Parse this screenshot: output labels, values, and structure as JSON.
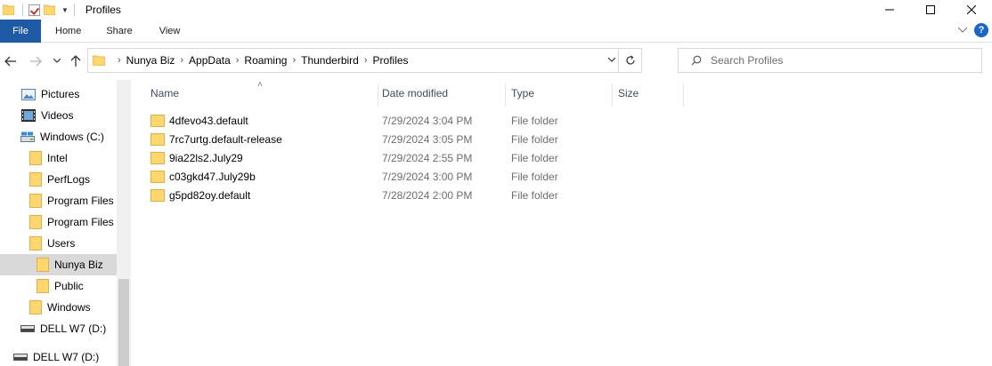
{
  "window": {
    "title": "Profiles"
  },
  "ribbon": {
    "tabs": [
      "File",
      "Home",
      "Share",
      "View"
    ]
  },
  "address": {
    "breadcrumbs": [
      "Nunya Biz",
      "AppData",
      "Roaming",
      "Thunderbird",
      "Profiles"
    ]
  },
  "search": {
    "placeholder": "Search Profiles"
  },
  "nav": {
    "items": [
      {
        "label": "Pictures",
        "icon": "pictures-icon"
      },
      {
        "label": "Videos",
        "icon": "videos-icon"
      },
      {
        "label": "Windows (C:)",
        "icon": "drive-icon"
      },
      {
        "label": "Intel",
        "icon": "folder-icon"
      },
      {
        "label": "PerfLogs",
        "icon": "folder-icon"
      },
      {
        "label": "Program Files",
        "icon": "folder-icon"
      },
      {
        "label": "Program Files (",
        "icon": "folder-icon"
      },
      {
        "label": "Users",
        "icon": "folder-icon"
      },
      {
        "label": "Nunya Biz",
        "icon": "folder-icon",
        "selected": true
      },
      {
        "label": "Public",
        "icon": "folder-icon"
      },
      {
        "label": "Windows",
        "icon": "folder-icon"
      },
      {
        "label": "DELL W7 (D:)",
        "icon": "usb-drive-icon"
      },
      {
        "label": "DELL W7 (D:)",
        "icon": "usb-drive-icon"
      }
    ]
  },
  "table": {
    "columns": [
      "Name",
      "Date modified",
      "Type",
      "Size"
    ],
    "rows": [
      {
        "name": "4dfevo43.default",
        "date": "7/29/2024 3:04 PM",
        "type": "File folder",
        "size": ""
      },
      {
        "name": "7rc7urtg.default-release",
        "date": "7/29/2024 3:05 PM",
        "type": "File folder",
        "size": ""
      },
      {
        "name": "9ia22ls2.July29",
        "date": "7/29/2024 2:55 PM",
        "type": "File folder",
        "size": ""
      },
      {
        "name": "c03gkd47.July29b",
        "date": "7/29/2024 3:00 PM",
        "type": "File folder",
        "size": ""
      },
      {
        "name": "g5pd82oy.default",
        "date": "7/28/2024 2:00 PM",
        "type": "File folder",
        "size": ""
      }
    ]
  },
  "colors": {
    "file_tab": "#1f5aa5",
    "folder": "#ffd76e",
    "selected_nav": "#d9d9d9",
    "header_text": "#3e4b5e"
  }
}
